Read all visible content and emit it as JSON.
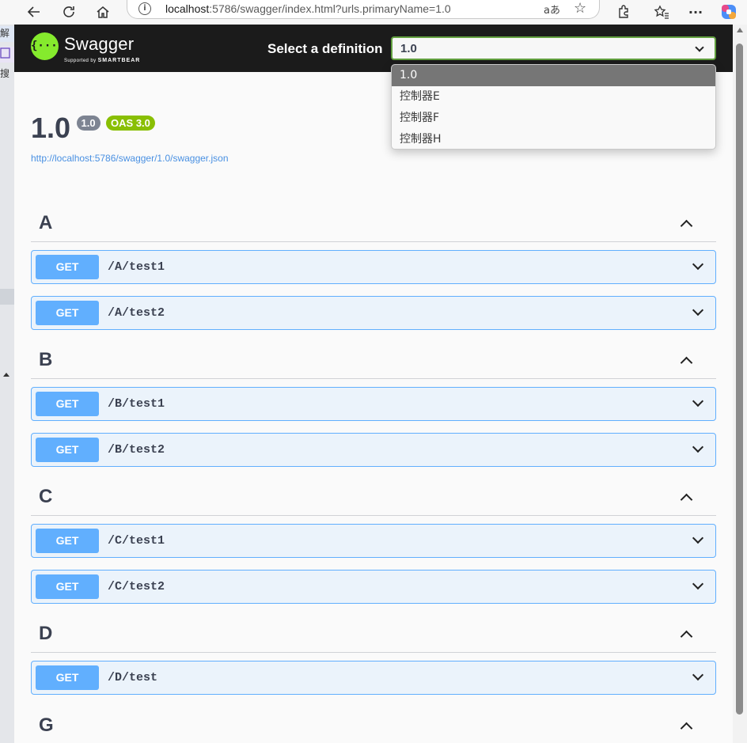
{
  "browser": {
    "url_host": "localhost",
    "url_rest": ":5786/swagger/index.html?urls.primaryName=1.0",
    "read_aloud": "aあ"
  },
  "sidebar_sliver": [
    "解",
    "",
    "搜"
  ],
  "swagger": {
    "logo_text": "Swagger",
    "logo_sub_prefix": "Supported by",
    "logo_sub_brand": "SMARTBEAR",
    "logo_glyph": "{···}",
    "select_label": "Select a definition",
    "selected_definition": "1.0",
    "definitions": [
      "1.0",
      "控制器E",
      "控制器F",
      "控制器H"
    ],
    "title": "1.0",
    "version_badge": "1.0",
    "oas_badge": "OAS 3.0",
    "spec_url": "http://localhost:5786/swagger/1.0/swagger.json"
  },
  "tags": [
    {
      "name": "A",
      "operations": [
        {
          "method": "GET",
          "path": "/A/test1"
        },
        {
          "method": "GET",
          "path": "/A/test2"
        }
      ]
    },
    {
      "name": "B",
      "operations": [
        {
          "method": "GET",
          "path": "/B/test1"
        },
        {
          "method": "GET",
          "path": "/B/test2"
        }
      ]
    },
    {
      "name": "C",
      "operations": [
        {
          "method": "GET",
          "path": "/C/test1"
        },
        {
          "method": "GET",
          "path": "/C/test2"
        }
      ]
    },
    {
      "name": "D",
      "operations": [
        {
          "method": "GET",
          "path": "/D/test"
        }
      ]
    },
    {
      "name": "G",
      "operations": []
    }
  ],
  "colors": {
    "get_method": "#61affe",
    "swagger_green": "#85ea2d",
    "topbar": "#1b1b1b",
    "oas_badge": "#89bf04"
  }
}
